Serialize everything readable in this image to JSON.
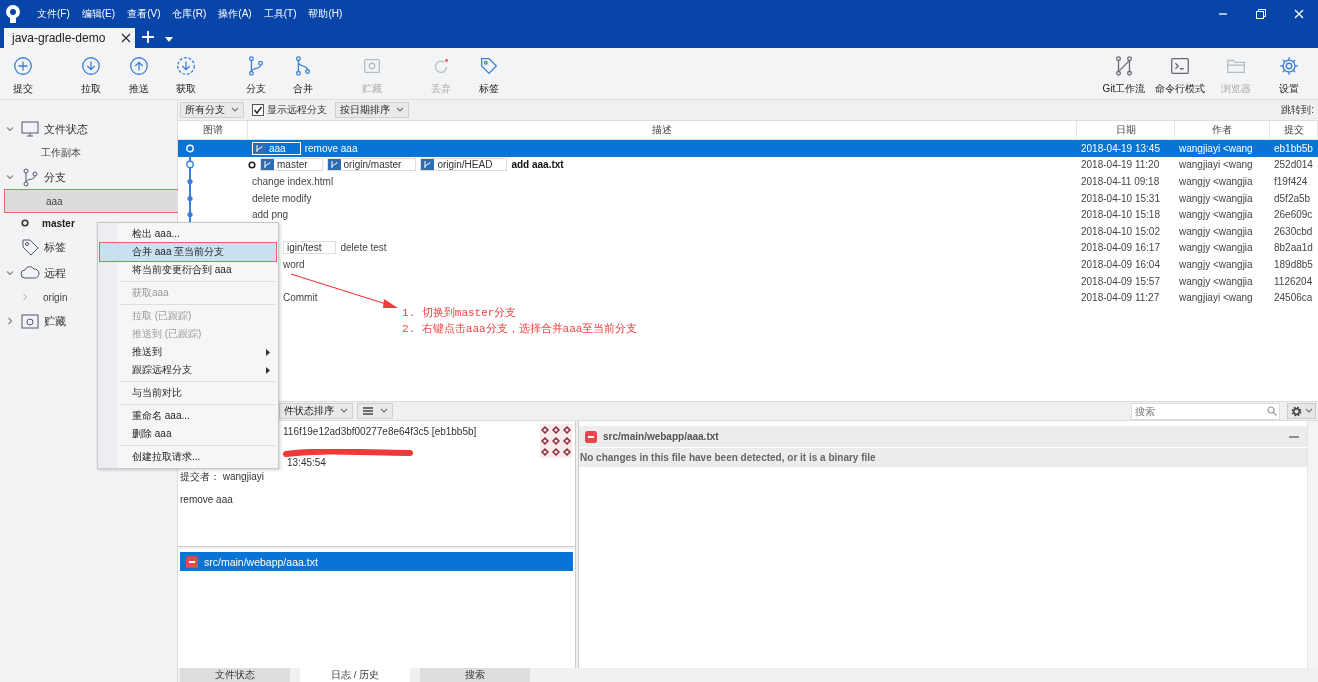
{
  "menu_bar": {
    "items": [
      "文件(F)",
      "编辑(E)",
      "查看(V)",
      "仓库(R)",
      "操作(A)",
      "工具(T)",
      "帮助(H)"
    ]
  },
  "tabs": [
    {
      "label": "java-gradle-demo",
      "selected": true
    }
  ],
  "toolbar": {
    "left": [
      {
        "label": "提交",
        "kind": "commit",
        "disabled": false
      },
      {
        "label": "拉取",
        "kind": "pull",
        "disabled": false
      },
      {
        "label": "推送",
        "kind": "push",
        "disabled": false
      },
      {
        "label": "获取",
        "kind": "fetch",
        "disabled": false
      },
      {
        "label": "分支",
        "kind": "branch",
        "disabled": false
      },
      {
        "label": "合并",
        "kind": "merge",
        "disabled": false
      },
      {
        "label": "贮藏",
        "kind": "stash",
        "disabled": true
      },
      {
        "label": "丢弃",
        "kind": "discard",
        "disabled": true
      },
      {
        "label": "标签",
        "kind": "tag",
        "disabled": false
      }
    ],
    "right": [
      {
        "label": "Git工作流",
        "kind": "gitflow",
        "disabled": false
      },
      {
        "label": "命令行模式",
        "kind": "terminal",
        "disabled": false
      },
      {
        "label": "浏览器",
        "kind": "browser",
        "disabled": true
      },
      {
        "label": "设置",
        "kind": "settings",
        "disabled": false
      }
    ]
  },
  "filter_bar": {
    "branch_filter": "所有分支",
    "show_remote": {
      "label": "显示远程分支",
      "checked": true
    },
    "sort": "按日期排序",
    "jump_label": "跳转到:"
  },
  "sidebar": {
    "items": [
      {
        "label": "文件状态",
        "kind": "workspace",
        "expanded": true,
        "children": [
          {
            "label": "工作副本",
            "selected": false,
            "current": false
          }
        ]
      },
      {
        "label": "分支",
        "kind": "branches",
        "expanded": true,
        "children": [
          {
            "label": "aaa",
            "selected": true,
            "current": false
          },
          {
            "label": "master",
            "selected": false,
            "current": true
          }
        ]
      },
      {
        "label": "标签",
        "kind": "tags"
      },
      {
        "label": "远程",
        "kind": "remotes",
        "expanded": true,
        "children": [
          {
            "label": "origin",
            "selected": false,
            "current": false,
            "expanded": false
          }
        ]
      },
      {
        "label": "贮藏",
        "kind": "stashes",
        "expanded": false
      }
    ]
  },
  "table": {
    "columns": [
      "图谱",
      "描述",
      "日期",
      "作者",
      "提交"
    ],
    "rows": [
      {
        "kind": "hollow",
        "selected": true,
        "current": false,
        "covered": false,
        "tags": [
          "aaa"
        ],
        "description": "remove aaa",
        "date": "2018-04-19 13:45",
        "author": "wangjiayi <wang",
        "commit": "eb1bb5b"
      },
      {
        "kind": "hollow",
        "selected": false,
        "current": true,
        "covered": false,
        "tags": [
          "master",
          "origin/master",
          "origin/HEAD"
        ],
        "description": "add aaa.txt",
        "date": "2018-04-19 11:20",
        "author": "wangjiayi <wang",
        "commit": "252d014"
      },
      {
        "kind": "dot",
        "selected": false,
        "current": false,
        "covered": false,
        "description": "change index.html",
        "date": "2018-04-11 09:18",
        "author": "wangjy <wangjia",
        "commit": "f19f424"
      },
      {
        "kind": "dot",
        "selected": false,
        "current": false,
        "covered": false,
        "description": "delete modify",
        "date": "2018-04-10 15:31",
        "author": "wangjy <wangjia",
        "commit": "d5f2a5b"
      },
      {
        "kind": "dot",
        "selected": false,
        "current": false,
        "covered": false,
        "description": "add png",
        "date": "2018-04-10 15:18",
        "author": "wangjy <wangjia",
        "commit": "26e609c"
      },
      {
        "selected": false,
        "current": false,
        "date": "2018-04-10 15:02",
        "author": "wangjy <wangjia",
        "commit": "2630cbd"
      },
      {
        "selected": false,
        "current": false,
        "covered": true,
        "tags": [
          "igin/test"
        ],
        "description": "delete test",
        "date": "2018-04-09 16:17",
        "author": "wangjy <wangjia",
        "commit": "8b2aa1d"
      },
      {
        "selected": false,
        "current": false,
        "covered": true,
        "description": "word",
        "date": "2018-04-09 16:04",
        "author": "wangjy <wangjia",
        "commit": "189d8b5"
      },
      {
        "selected": false,
        "current": false,
        "date": "2018-04-09 15:57",
        "author": "wangjy <wangjia",
        "commit": "1126204"
      },
      {
        "selected": false,
        "current": false,
        "covered": true,
        "description": "Commit",
        "date": "2018-04-09 11:27",
        "author": "wangjiayi <wang",
        "commit": "24506ca"
      }
    ]
  },
  "context_menu": {
    "items": [
      {
        "kind": "item",
        "label": "检出 aaa...",
        "selected": false,
        "disabled": false
      },
      {
        "kind": "item",
        "label": "合并 aaa 至当前分支",
        "selected": true,
        "disabled": false
      },
      {
        "kind": "item",
        "label": "将当前变更衍合到 aaa",
        "selected": false,
        "disabled": false
      },
      {
        "kind": "separator"
      },
      {
        "kind": "item",
        "label": "获取aaa",
        "selected": false,
        "disabled": true
      },
      {
        "kind": "separator"
      },
      {
        "kind": "item",
        "label": "拉取 (已跟踪)",
        "selected": false,
        "disabled": true
      },
      {
        "kind": "item",
        "label": "推送到 (已跟踪)",
        "selected": false,
        "disabled": true
      },
      {
        "kind": "submenu",
        "label": "推送到",
        "selected": false,
        "disabled": false
      },
      {
        "kind": "submenu",
        "label": "跟踪远程分支",
        "selected": false,
        "disabled": false
      },
      {
        "kind": "separator"
      },
      {
        "kind": "item",
        "label": "与当前对比",
        "selected": false,
        "disabled": false
      },
      {
        "kind": "separator"
      },
      {
        "kind": "item",
        "label": "重命名 aaa...",
        "selected": false,
        "disabled": false
      },
      {
        "kind": "item",
        "label": "删除 aaa",
        "selected": false,
        "disabled": false
      },
      {
        "kind": "separator"
      },
      {
        "kind": "item",
        "label": "创建拉取请求...",
        "selected": false,
        "disabled": false
      }
    ]
  },
  "lower_toolbar": {
    "sort": "件状态排序",
    "search_placeholder": "搜索"
  },
  "commit_details": {
    "hash": "116f19e12ad3bf00277e8e64f3c5 [eb1bb5b]",
    "time": "13:45:54",
    "committer": "提交者： wangjiayi",
    "message": "remove aaa"
  },
  "files": [
    {
      "path": "src/main/webapp/aaa.txt",
      "kind": "removed",
      "selected": true
    }
  ],
  "diff": {
    "path": "src/main/webapp/aaa.txt",
    "kind": "removed",
    "message": "No changes in this file have been detected, or it is a binary file"
  },
  "bottom_tabs": [
    {
      "label": "文件状态",
      "selected": false
    },
    {
      "label": "日志 / 历史",
      "selected": true
    },
    {
      "label": "搜索",
      "selected": false
    }
  ],
  "annotation": {
    "lines": [
      "1. 切换到master分支",
      "2. 右键点击aaa分支，选择合并aaa至当前分支"
    ]
  }
}
